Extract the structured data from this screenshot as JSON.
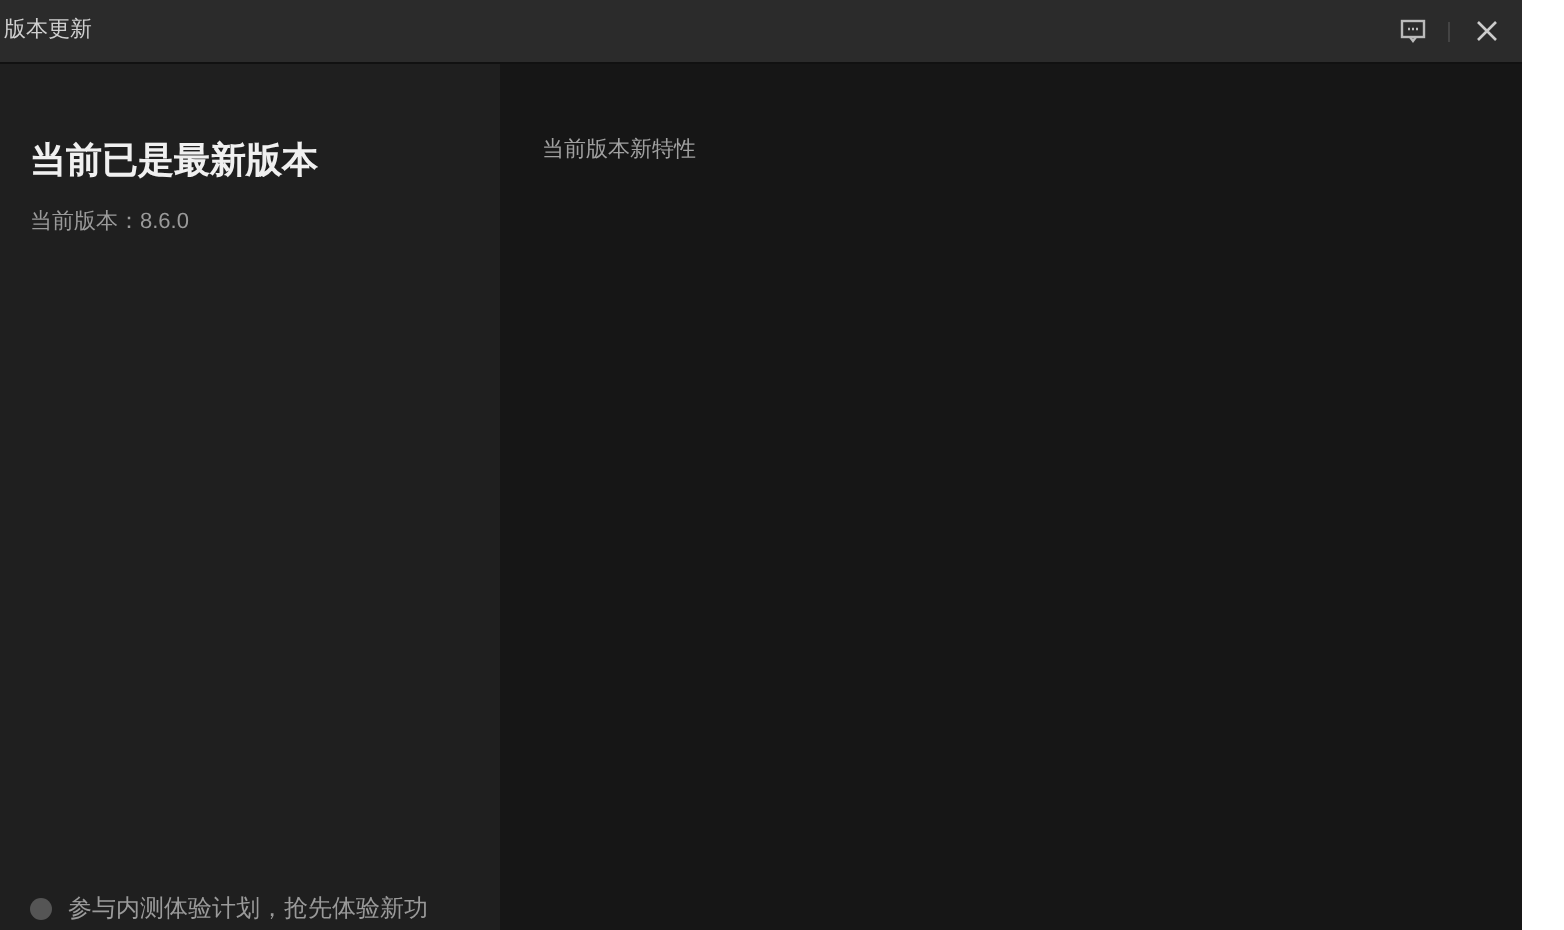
{
  "window": {
    "title": "版本更新"
  },
  "status": {
    "heading": "当前已是最新版本",
    "version": "当前版本：8.6.0"
  },
  "beta": {
    "label": "参与内测体验计划，抢先体验新功",
    "checked": false
  },
  "features": {
    "title": "当前版本新特性"
  }
}
